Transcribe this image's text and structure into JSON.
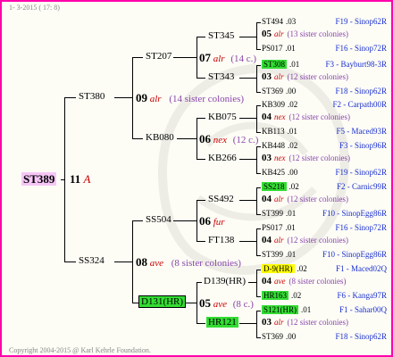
{
  "header": {
    "date": "1- 3-2015 ( 17: 8)"
  },
  "footer": {
    "copyright": "Copyright 2004-2015 @ Karl Kehrle Foundation."
  },
  "root": {
    "name": "ST389",
    "year": "11",
    "breed": "A"
  },
  "gen1": [
    {
      "name": "ST380",
      "year": "09",
      "breed": "alr",
      "note": "(14 sister colonies)"
    },
    {
      "name": "SS324",
      "year": "08",
      "breed": "ave",
      "note": "(8 sister colonies)"
    }
  ],
  "gen2": [
    {
      "name": "ST207",
      "year": "07",
      "breed": "alr",
      "note": "(14 c.)"
    },
    {
      "name": "KB080",
      "year": "06",
      "breed": "nex",
      "note": "(12 c.)"
    },
    {
      "name": "SS504",
      "year": "06",
      "breed": "fur",
      "note": ""
    },
    {
      "name": "D131(HR)",
      "year": "05",
      "breed": "ave",
      "note": "(8 c.)"
    }
  ],
  "gen3": [
    {
      "name": "ST345"
    },
    {
      "name": "ST343"
    },
    {
      "name": "KB075"
    },
    {
      "name": "KB266"
    },
    {
      "name": "SS492"
    },
    {
      "name": "FT138"
    },
    {
      "name": "D139(HR)"
    },
    {
      "name": "HR121"
    }
  ],
  "gen4": [
    {
      "name": "ST494",
      "year": ".03",
      "origin": "F19 - Sinop62R"
    },
    {
      "year": "05",
      "breed": "alr",
      "note": "(13 sister colonies)"
    },
    {
      "name": "PS017",
      "year": ".01",
      "origin": "F16 - Sinop72R"
    },
    {
      "name": "ST308",
      "year": ".01",
      "origin": "F3 - Bayburt98-3R"
    },
    {
      "year": "03",
      "breed": "alr",
      "note": "(12 sister colonies)"
    },
    {
      "name": "ST369",
      "year": ".00",
      "origin": "F18 - Sinop62R"
    },
    {
      "name": "KB309",
      "year": ".02",
      "origin": "F2 - Carpath00R"
    },
    {
      "year": "04",
      "breed": "nex",
      "note": "(12 sister colonies)"
    },
    {
      "name": "KB113",
      "year": ".01",
      "origin": "F5 - Maced93R"
    },
    {
      "name": "KB448",
      "year": ".02",
      "origin": "F3 - Sinop96R"
    },
    {
      "year": "03",
      "breed": "nex",
      "note": "(12 sister colonies)"
    },
    {
      "name": "KB425",
      "year": ".00",
      "origin": "F19 - Sinop62R"
    },
    {
      "name": "SS218",
      "year": ".02",
      "origin": "F2 - Carnic99R"
    },
    {
      "year": "04",
      "breed": "alr",
      "note": "(12 sister colonies)"
    },
    {
      "name": "ST399",
      "year": ".01",
      "origin": "F10 - SinopEgg86R"
    },
    {
      "name": "PS017",
      "year": ".01",
      "origin": "F16 - Sinop72R"
    },
    {
      "year": "04",
      "breed": "alr",
      "note": "(12 sister colonies)"
    },
    {
      "name": "ST399",
      "year": ".01",
      "origin": "F10 - SinopEgg86R"
    },
    {
      "name": "D-9(HR)",
      "year": ".02",
      "origin": "F1 - Maced02Q"
    },
    {
      "year": "04",
      "breed": "ave",
      "note": "(8 sister colonies)"
    },
    {
      "name": "HR163",
      "year": ".02",
      "origin": "F6 - Kanga97R"
    },
    {
      "name": "S121(HR)",
      "year": ".01",
      "origin": "F1 - Sahar00Q"
    },
    {
      "year": "03",
      "breed": "alr",
      "note": "(12 sister colonies)"
    },
    {
      "name": "ST369",
      "year": ".00",
      "origin": "F18 - Sinop62R"
    }
  ],
  "colors": {
    "frame": "#ff00aa",
    "highlight_green": "#33dd33",
    "highlight_yellow": "#ffff00",
    "root_bg": "#f6c7f6",
    "breed_red": "#cc0000",
    "note_purple": "#8844aa",
    "origin_blue": "#1a2fcf"
  }
}
